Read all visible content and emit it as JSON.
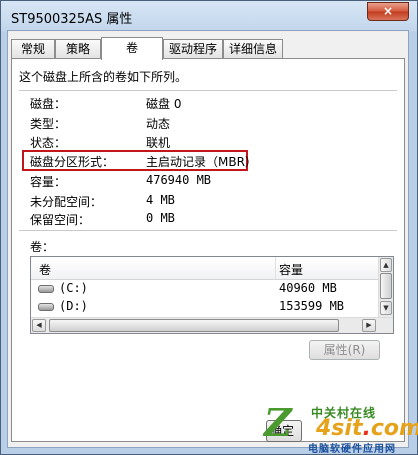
{
  "window": {
    "title": "ST9500325AS 属性",
    "close_label": "×"
  },
  "tabs": [
    {
      "label": "常规"
    },
    {
      "label": "策略"
    },
    {
      "label": "卷",
      "active": true
    },
    {
      "label": "驱动程序"
    },
    {
      "label": "详细信息"
    }
  ],
  "volume_tab": {
    "description": "这个磁盘上所含的卷如下所列。",
    "properties": [
      {
        "label": "磁盘：",
        "value": "磁盘 0"
      },
      {
        "label": "类型：",
        "value": "动态"
      },
      {
        "label": "状态：",
        "value": "联机"
      },
      {
        "label": "磁盘分区形式：",
        "value": "主启动记录（MBR）"
      },
      {
        "label": "容量：",
        "value": "476940 MB"
      },
      {
        "label": "未分配空间：",
        "value": "4 MB"
      },
      {
        "label": "保留空间：",
        "value": "0 MB"
      }
    ],
    "volumes_label": "卷：",
    "list": {
      "columns": [
        "卷",
        "容量"
      ],
      "rows": [
        {
          "volume": "(C:)",
          "capacity": "40960 MB"
        },
        {
          "volume": "(D:)",
          "capacity": "153599 MB"
        }
      ]
    },
    "properties_button": "属性(R)"
  },
  "footer": {
    "ok_button": "确定"
  },
  "watermark": {
    "top": "中关村在线",
    "logo_main": "4sit",
    "logo_dot": ".",
    "logo_tail": "com",
    "bottom": "电脑软硬件应用网"
  },
  "colors": {
    "highlight_border": "#c2161b",
    "title_bar": "#c2d6ec"
  }
}
